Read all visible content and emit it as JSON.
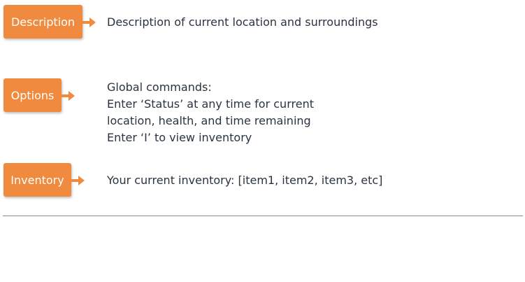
{
  "rows": [
    {
      "label": "Description",
      "text_lines": [
        "Description of current location and surroundings"
      ]
    },
    {
      "label": "Options",
      "text_lines": [
        "Global commands:",
        "Enter ‘Status’ at any time for current",
        "location, health, and time remaining",
        "Enter ‘I’ to view inventory"
      ]
    },
    {
      "label": "Inventory",
      "text_lines": [
        "Your current inventory: [item1, item2, item3, etc]"
      ]
    }
  ],
  "colors": {
    "tag": "#ef8a3e",
    "text": "#2a3440",
    "divider": "#7f8d99"
  }
}
